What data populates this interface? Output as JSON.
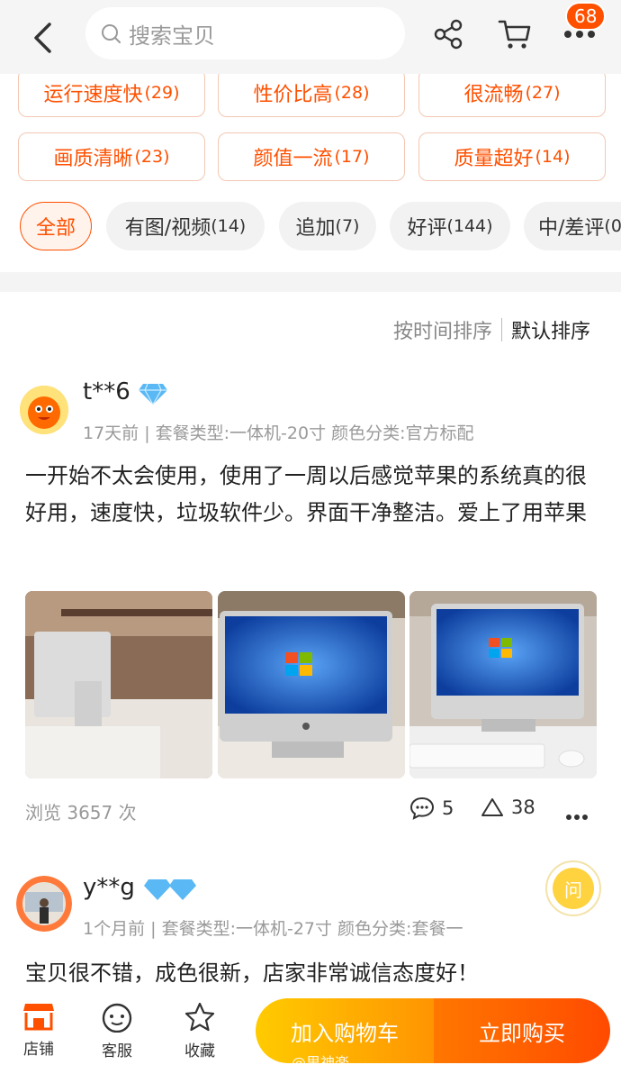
{
  "header": {
    "search_placeholder": "搜索宝贝",
    "cart_badge": "68",
    "icons": [
      "back-icon",
      "search-icon",
      "share-icon",
      "cart-icon",
      "more-icon"
    ]
  },
  "tags": [
    {
      "label": "运行速度快",
      "count": "(29)"
    },
    {
      "label": "性价比高",
      "count": "(28)"
    },
    {
      "label": "很流畅",
      "count": "(27)"
    },
    {
      "label": "画质清晰",
      "count": "(23)"
    },
    {
      "label": "颜值一流",
      "count": "(17)"
    },
    {
      "label": "质量超好",
      "count": "(14)"
    }
  ],
  "filters": [
    {
      "label": "全部",
      "count": ""
    },
    {
      "label": "有图/视频",
      "count": "(14)"
    },
    {
      "label": "追加",
      "count": "(7)"
    },
    {
      "label": "好评",
      "count": "(144)"
    },
    {
      "label": "中/差评",
      "count": "(0"
    }
  ],
  "sort": {
    "by_time": "按时间排序",
    "default": "默认排序"
  },
  "reviews": [
    {
      "user": "t**6",
      "meta": "17天前 | 套餐类型:一体机-20寸 颜色分类:官方标配",
      "text": "一开始不太会使用，使用了一周以后感觉苹果的系统真的很好用，速度快，垃圾软件少。界面干净整洁。爱上了用苹果",
      "views": "浏览 3657 次",
      "comments": "5",
      "likes": "38"
    },
    {
      "user": "y**g",
      "meta": "1个月前 | 套餐类型:一体机-27寸 颜色分类:套餐一",
      "text": "宝贝很不错，成色很新，店家非常诚信态度好！"
    }
  ],
  "ask_label": "问",
  "bottom": {
    "store": "店铺",
    "service": "客服",
    "favorite": "收藏",
    "add_cart": "加入购物车",
    "buy_now": "立即购买"
  },
  "watermark": "@里神楽",
  "colors": {
    "accent": "#ff5000",
    "cart_gradient": [
      "#ffcb00",
      "#ff9402"
    ],
    "buy_gradient": [
      "#ff7700",
      "#ff4a00"
    ]
  }
}
